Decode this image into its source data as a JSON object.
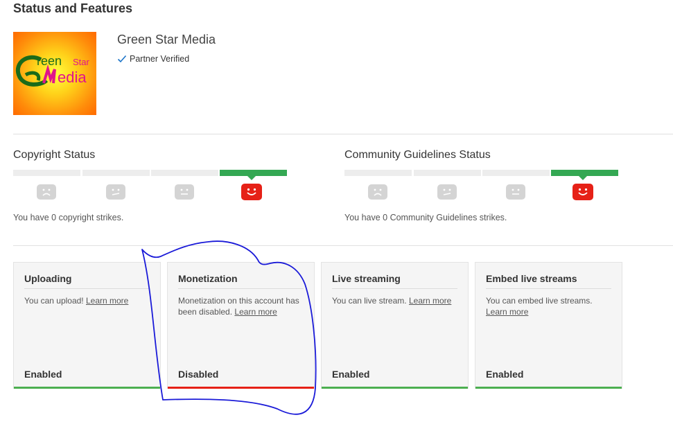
{
  "page": {
    "title": "Status and Features"
  },
  "channel": {
    "name": "Green Star Media",
    "partner_label": "Partner Verified",
    "logo": {
      "text_green": "reen",
      "text_star": "Star",
      "text_media": "edia",
      "colors": {
        "green": "#1a6b1a",
        "pink": "#e0148c",
        "background": "#ffd21a"
      }
    }
  },
  "copyright": {
    "title": "Copyright Status",
    "message": "You have 0 copyright strikes.",
    "strikes": 0
  },
  "community": {
    "title": "Community Guidelines Status",
    "message": "You have 0 Community Guidelines strikes.",
    "strikes": 0
  },
  "features": [
    {
      "title": "Uploading",
      "desc": "You can upload!",
      "link": "Learn more",
      "status": "Enabled",
      "state": "ok"
    },
    {
      "title": "Monetization",
      "desc": "Monetization on this account has been disabled.",
      "link": "Learn more",
      "status": "Disabled",
      "state": "bad"
    },
    {
      "title": "Live streaming",
      "desc": "You can live stream.",
      "link": "Learn more",
      "status": "Enabled",
      "state": "ok"
    },
    {
      "title": "Embed live streams",
      "desc": "You can embed live streams.",
      "link": "Learn more",
      "status": "Enabled",
      "state": "ok"
    }
  ],
  "colors": {
    "good": "#34a853",
    "bad": "#e62117",
    "annotation": "#1a1ad8"
  },
  "icons": [
    "check-icon",
    "sad-face-icon",
    "neutral-face-icon",
    "smile-face-icon"
  ]
}
